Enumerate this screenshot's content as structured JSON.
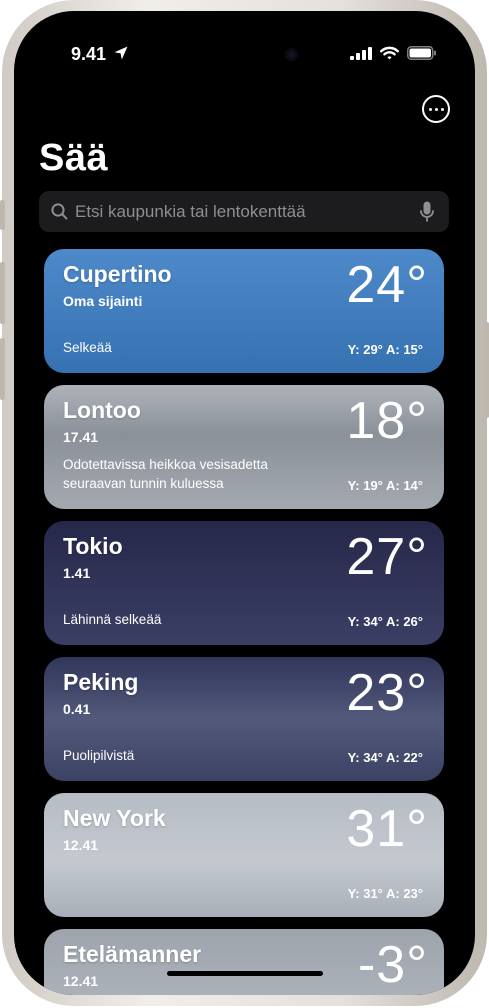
{
  "status_bar": {
    "time": "9.41"
  },
  "header": {
    "title": "Sää"
  },
  "search": {
    "placeholder": "Etsi kaupunkia tai lentokenttää"
  },
  "cities": [
    {
      "name": "Cupertino",
      "subtitle": "Oma sijainti",
      "temp": "24°",
      "condition": "Selkeää",
      "hilo": "Y: 29° A: 15°"
    },
    {
      "name": "Lontoo",
      "subtitle": "17.41",
      "temp": "18°",
      "condition": "Odotettavissa heikkoa vesisadetta seuraavan tunnin kuluessa",
      "hilo": "Y: 19° A: 14°"
    },
    {
      "name": "Tokio",
      "subtitle": "1.41",
      "temp": "27°",
      "condition": "Lähinnä selkeää",
      "hilo": "Y: 34° A: 26°"
    },
    {
      "name": "Peking",
      "subtitle": "0.41",
      "temp": "23°",
      "condition": "Puolipilvistä",
      "hilo": "Y: 34° A: 22°"
    },
    {
      "name": "New York",
      "subtitle": "12.41",
      "temp": "31°",
      "condition": "",
      "hilo": "Y: 31° A: 23°"
    },
    {
      "name": "Etelämanner",
      "subtitle": "12.41",
      "temp": "-3°",
      "condition": "",
      "hilo": ""
    }
  ],
  "icons": {
    "location": "location-arrow-icon",
    "signal": "cellular-signal-icon",
    "wifi": "wifi-icon",
    "battery": "battery-icon",
    "more": "ellipsis-circle-icon",
    "search": "magnifying-glass-icon",
    "mic": "microphone-icon"
  },
  "colors": {
    "background": "#000000",
    "search_field": "#1c1c1e",
    "placeholder": "#8e8e93",
    "card_cupertino": "#4a84c4",
    "card_lontoo": "#9aa0a8",
    "card_tokio": "#2c2f52",
    "card_peking": "#434a6e",
    "card_newyork": "#bcc2c9",
    "card_etelamanner": "#a7adb5"
  }
}
